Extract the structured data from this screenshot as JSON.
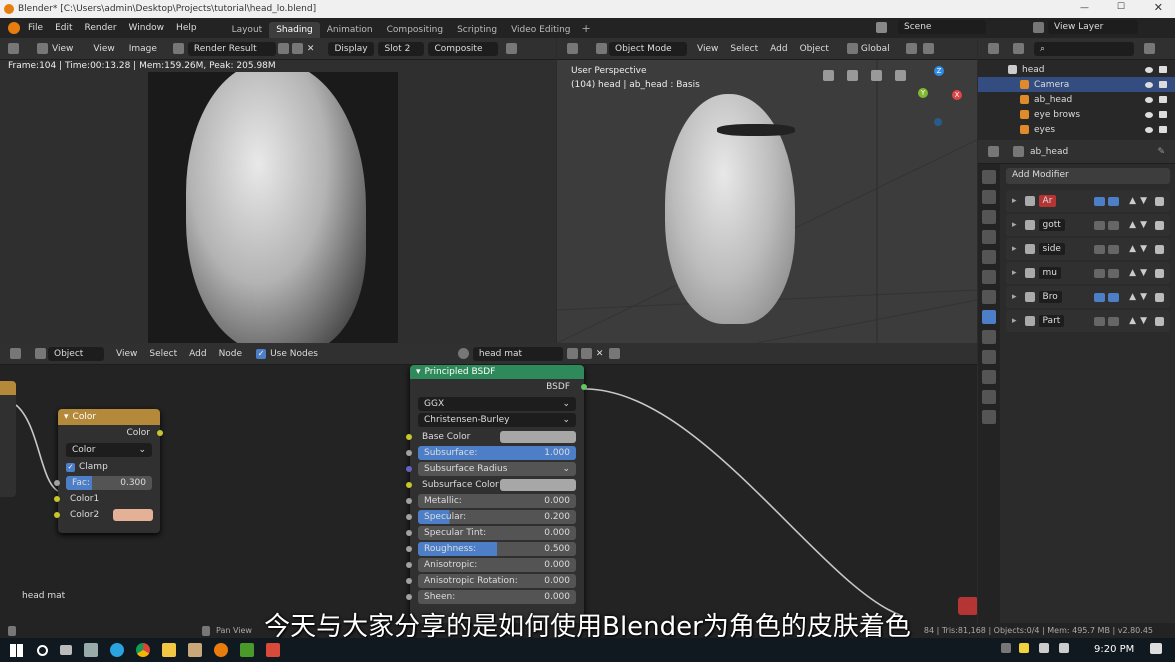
{
  "titlebar": {
    "title": "Blender* [C:\\Users\\admin\\Desktop\\Projects\\tutorial\\head_lo.blend]"
  },
  "menu": [
    "File",
    "Edit",
    "Render",
    "Window",
    "Help"
  ],
  "workspaces": [
    {
      "label": "Layout"
    },
    {
      "label": "Shading",
      "active": true
    },
    {
      "label": "Animation"
    },
    {
      "label": "Compositing"
    },
    {
      "label": "Scripting"
    },
    {
      "label": "Video Editing"
    }
  ],
  "scene_label": "Scene",
  "view_layer_label": "View Layer",
  "image_editor": {
    "menus": [
      "View",
      "View",
      "Image"
    ],
    "render_result": "Render Result",
    "display": "Display",
    "slot": "Slot 2",
    "composite": "Composite",
    "stats": "Frame:104 | Time:00:13.28 | Mem:159.26M, Peak: 205.98M"
  },
  "viewport": {
    "mode": "Object Mode",
    "menus": [
      "View",
      "Select",
      "Add",
      "Object"
    ],
    "orientation": "Global",
    "label1": "User Perspective",
    "label2": "(104) head | ab_head : Basis",
    "gizmo": {
      "x": "X",
      "y": "Y",
      "z": "Z"
    }
  },
  "outliner": {
    "items": [
      {
        "name": "head",
        "selected": false
      },
      {
        "name": "Camera",
        "selected": true
      },
      {
        "name": "ab_head",
        "selected": false
      },
      {
        "name": "eye brows",
        "selected": false
      },
      {
        "name": "eyes",
        "selected": false
      }
    ]
  },
  "properties": {
    "object_name": "ab_head",
    "add_modifier": "Add Modifier",
    "modifiers": [
      "Ar",
      "gott",
      "side",
      "mu",
      "Bro",
      "Part"
    ]
  },
  "node_editor": {
    "object": "Object",
    "menus": [
      "View",
      "Select",
      "Add",
      "Node"
    ],
    "use_nodes": "Use Nodes",
    "material": "head mat",
    "footer_label": "head mat"
  },
  "color_node": {
    "title": "Color",
    "output": "Color",
    "blend": "Color",
    "clamp": "Clamp",
    "fac_label": "Fac:",
    "fac_value": "0.300",
    "fac": 0.3,
    "color1": "Color1",
    "color2": "Color2",
    "color2_swatch": "#e4b096"
  },
  "bsdf_node": {
    "title": "Principled BSDF",
    "output": "BSDF",
    "distribution": "GGX",
    "subsurface_method": "Christensen-Burley",
    "base_color": "Base Color",
    "subsurface": {
      "label": "Subsurface:",
      "value": "1.000"
    },
    "subsurface_radius": "Subsurface Radius",
    "subsurface_color": "Subsurface Color",
    "metallic": {
      "label": "Metallic:",
      "value": "0.000"
    },
    "specular": {
      "label": "Specular:",
      "value": "0.200"
    },
    "specular_tint": {
      "label": "Specular Tint:",
      "value": "0.000"
    },
    "roughness": {
      "label": "Roughness:",
      "value": "0.500"
    },
    "anisotropic": {
      "label": "Anisotropic:",
      "value": "0.000"
    },
    "anisotropic_rotation": {
      "label": "Anisotropic Rotation:",
      "value": "0.000"
    },
    "sheen": {
      "label": "Sheen:",
      "value": "0.000"
    }
  },
  "statusbar": {
    "pan_view": "Pan View",
    "stats": "84 | Tris:81,168 | Objects:0/4 | Mem: 495.7 MB | v2.80.45"
  },
  "subtitle": "今天与大家分享的是如何使用Blender为角色的皮肤着色",
  "taskbar": {
    "time": "9:20 PM"
  }
}
